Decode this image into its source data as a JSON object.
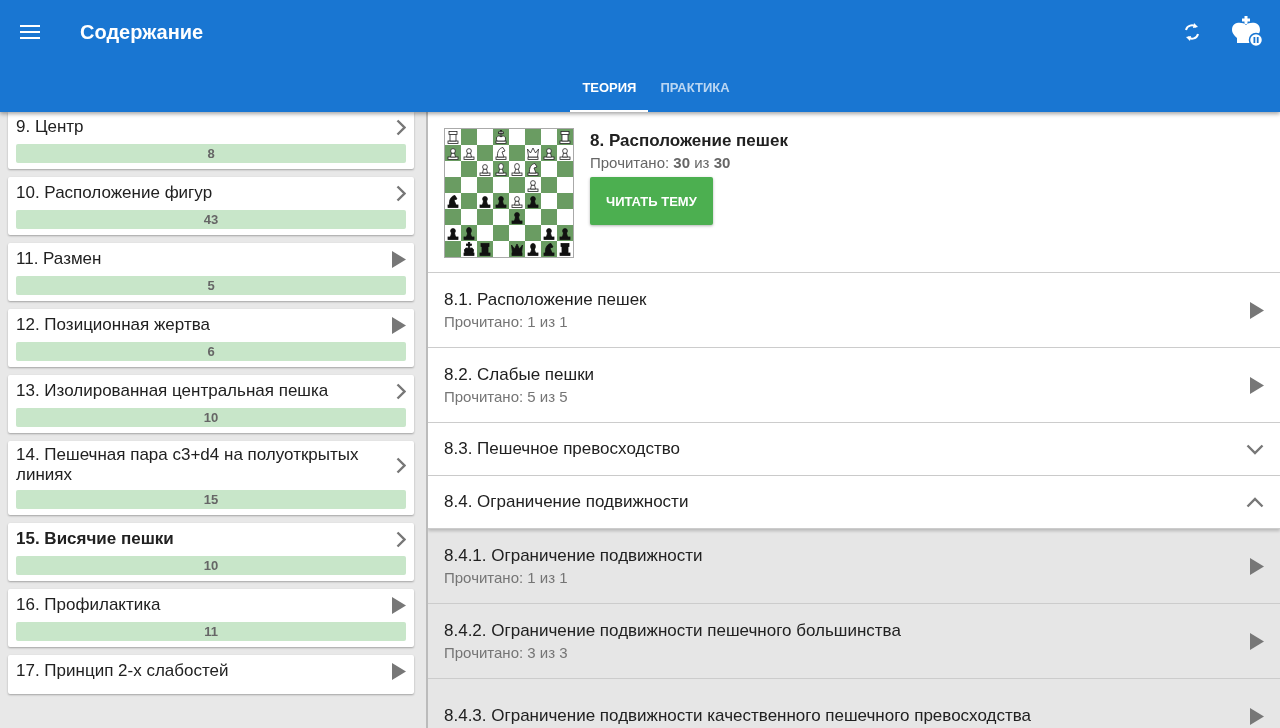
{
  "app_bar": {
    "title": "Содержание"
  },
  "tabs": [
    {
      "label": "ТЕОРИЯ",
      "selected": true
    },
    {
      "label": "ПРАКТИКА",
      "selected": false
    }
  ],
  "chapters": [
    {
      "title": "9. Центр",
      "count": "8",
      "kind": "chevron",
      "selected": false
    },
    {
      "title": "10. Расположение фигур",
      "count": "43",
      "kind": "chevron",
      "selected": false
    },
    {
      "title": "11. Размен",
      "count": "5",
      "kind": "play",
      "selected": false
    },
    {
      "title": "12. Позиционная жертва",
      "count": "6",
      "kind": "play",
      "selected": false
    },
    {
      "title": "13. Изолированная центральная пешка",
      "count": "10",
      "kind": "chevron",
      "selected": false
    },
    {
      "title": "14. Пешечная пара c3+d4 на полуоткрытых линиях",
      "count": "15",
      "kind": "chevron",
      "selected": false
    },
    {
      "title": "15. Висячие пешки",
      "count": "10",
      "kind": "chevron",
      "selected": true
    },
    {
      "title": "16. Профилактика",
      "count": "11",
      "kind": "play",
      "selected": false
    },
    {
      "title": "17. Принцип 2-х слабостей",
      "kind": "play",
      "selected": false
    }
  ],
  "chapter": {
    "title": "8. Расположение пешек",
    "progress": "Прочитано: **30** из **30**",
    "button": "ЧИТАТЬ ТЕМУ"
  },
  "topics": [
    {
      "kind": "topic",
      "title": "8.1. Расположение пешек",
      "progress": "Прочитано: 1 из 1"
    },
    {
      "kind": "topic",
      "title": "8.2. Слабые пешки",
      "progress": "Прочитано: 5 из 5"
    },
    {
      "kind": "group",
      "title": "8.3. Пешечное превосходство",
      "expanded": false
    },
    {
      "kind": "group",
      "title": "8.4. Ограничение подвижности",
      "expanded": true,
      "children": [
        {
          "title": "8.4.1. Ограничение подвижности",
          "progress": "Прочитано: 1 из 1"
        },
        {
          "title": "8.4.2. Ограничение подвижности пешечного большинства",
          "progress": "Прочитано: 3 из 3"
        },
        {
          "title": "8.4.3. Ограничение подвижности качественного пешечного превосходства"
        }
      ]
    }
  ]
}
